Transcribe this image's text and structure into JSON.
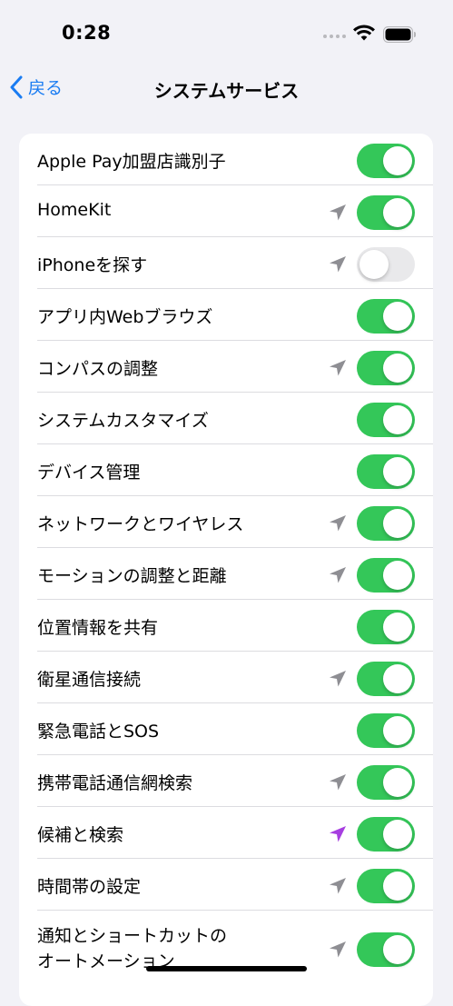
{
  "status_bar": {
    "time": "0:28",
    "wifi_icon": "wifi-icon",
    "battery_icon": "battery-icon"
  },
  "nav": {
    "back_label": "戻る",
    "back_icon": "chevron-left-icon",
    "title": "システムサービス"
  },
  "colors": {
    "accent": "#1a7cf2",
    "toggle_on": "#34c759",
    "toggle_off": "#e9e9eb",
    "location_gray": "#8e8e93",
    "location_purple": "#a63ee0",
    "background": "#f2f2f7"
  },
  "services": [
    {
      "label": "Apple Pay加盟店識別子",
      "location_icon": null,
      "enabled": true
    },
    {
      "label": "HomeKit",
      "location_icon": "gray",
      "enabled": true
    },
    {
      "label": "iPhoneを探す",
      "location_icon": "gray",
      "enabled": false
    },
    {
      "label": "アプリ内Webブラウズ",
      "location_icon": null,
      "enabled": true
    },
    {
      "label": "コンパスの調整",
      "location_icon": "gray",
      "enabled": true
    },
    {
      "label": "システムカスタマイズ",
      "location_icon": null,
      "enabled": true
    },
    {
      "label": "デバイス管理",
      "location_icon": null,
      "enabled": true
    },
    {
      "label": "ネットワークとワイヤレス",
      "location_icon": "gray",
      "enabled": true
    },
    {
      "label": "モーションの調整と距離",
      "location_icon": "gray",
      "enabled": true
    },
    {
      "label": "位置情報を共有",
      "location_icon": null,
      "enabled": true
    },
    {
      "label": "衛星通信接続",
      "location_icon": "gray",
      "enabled": true
    },
    {
      "label": "緊急電話とSOS",
      "location_icon": null,
      "enabled": true
    },
    {
      "label": "携帯電話通信網検索",
      "location_icon": "gray",
      "enabled": true
    },
    {
      "label": "候補と検索",
      "location_icon": "purple",
      "enabled": true
    },
    {
      "label": "時間帯の設定",
      "location_icon": "gray",
      "enabled": true
    },
    {
      "label": "通知とショートカットの\nオートメーション",
      "location_icon": "gray",
      "enabled": true
    }
  ]
}
